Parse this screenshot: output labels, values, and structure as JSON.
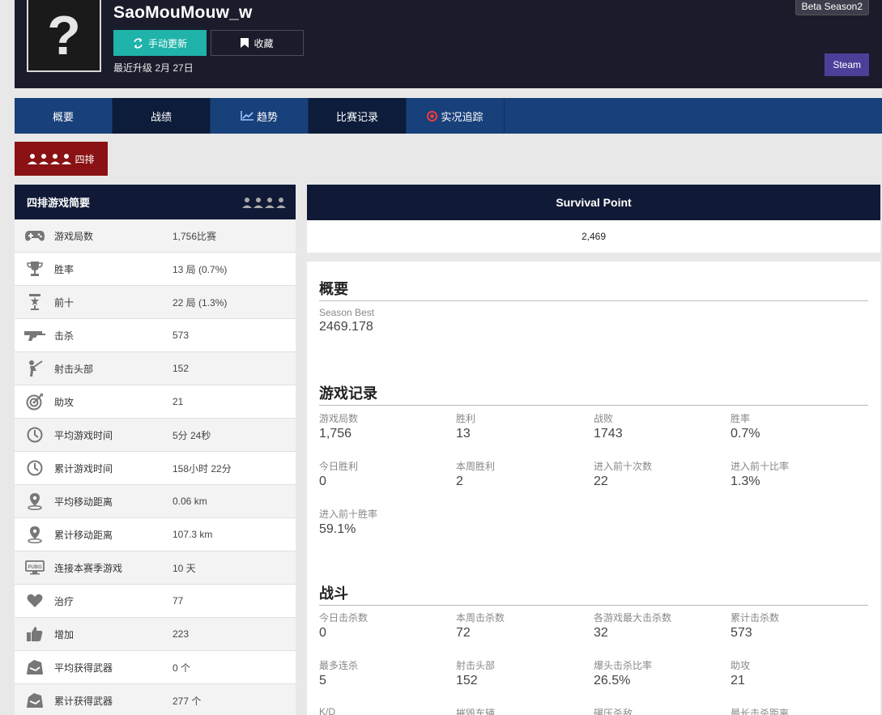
{
  "header": {
    "avatar_glyph": "?",
    "player_name": "SaoMouMouw_w",
    "refresh_label": "手动更新",
    "favorite_label": "收藏",
    "last_update": "最近升级 2月 27日",
    "season_badge": "Beta Season2",
    "platform_badge": "Steam"
  },
  "nav": {
    "overview": "概要",
    "record": "战绩",
    "trend": "趋势",
    "matches": "比赛记录",
    "live": "实况追踪"
  },
  "mode_button": "四排",
  "summary": {
    "title": "四排游戏简要",
    "rows": [
      {
        "icon": "gamepad-icon",
        "label": "游戏局数",
        "value": "1,756比赛"
      },
      {
        "icon": "trophy-icon",
        "label": "胜率",
        "value": "13 局 (0.7%)"
      },
      {
        "icon": "medal-icon",
        "label": "前十",
        "value": "22 局 (1.3%)"
      },
      {
        "icon": "gun-icon",
        "label": "击杀",
        "value": "573"
      },
      {
        "icon": "headshot-icon",
        "label": "射击头部",
        "value": "152"
      },
      {
        "icon": "target-icon",
        "label": "助攻",
        "value": "21"
      },
      {
        "icon": "clock-icon",
        "label": "平均游戏时间",
        "value": "5分 24秒"
      },
      {
        "icon": "clock-icon",
        "label": "累计游戏时间",
        "value": "158小时 22分"
      },
      {
        "icon": "location-icon",
        "label": "平均移动距离",
        "value": "0.06 km"
      },
      {
        "icon": "location-icon",
        "label": "累计移动距离",
        "value": "107.3 km"
      },
      {
        "icon": "pubg-logo-icon",
        "label": "连接本赛季游戏",
        "value": "10 天"
      },
      {
        "icon": "heart-icon",
        "label": "治疗",
        "value": "77"
      },
      {
        "icon": "thumbs-up-icon",
        "label": "增加",
        "value": "223"
      },
      {
        "icon": "backpack-icon",
        "label": "平均获得武器",
        "value": "0 个"
      },
      {
        "icon": "backpack-icon",
        "label": "累计获得武器",
        "value": "277 个"
      }
    ]
  },
  "survival": {
    "title": "Survival Point",
    "value": "2,469"
  },
  "overview": {
    "title": "概要",
    "season_best_label": "Season Best",
    "season_best_value": "2469.178"
  },
  "game_record": {
    "title": "游戏记录",
    "cells": [
      {
        "label": "游戏局数",
        "value": "1,756"
      },
      {
        "label": "胜利",
        "value": "13"
      },
      {
        "label": "战败",
        "value": "1743"
      },
      {
        "label": "胜率",
        "value": "0.7%"
      },
      {
        "label": "今日胜利",
        "value": "0"
      },
      {
        "label": "本周胜利",
        "value": "2"
      },
      {
        "label": "进入前十次数",
        "value": "22"
      },
      {
        "label": "进入前十比率",
        "value": "1.3%"
      },
      {
        "label": "进入前十胜率",
        "value": "59.1%"
      }
    ]
  },
  "combat": {
    "title": "战斗",
    "cells": [
      {
        "label": "今日击杀数",
        "value": "0"
      },
      {
        "label": "本周击杀数",
        "value": "72"
      },
      {
        "label": "各游戏最大击杀数",
        "value": "32"
      },
      {
        "label": "累计击杀数",
        "value": "573"
      },
      {
        "label": "最多连杀",
        "value": "5"
      },
      {
        "label": "射击头部",
        "value": "152"
      },
      {
        "label": "爆头击杀比率",
        "value": "26.5%"
      },
      {
        "label": "助攻",
        "value": "21"
      },
      {
        "label": "K/D",
        "value": ""
      },
      {
        "label": "摧毁车辆",
        "value": ""
      },
      {
        "label": "碾压杀敌",
        "value": ""
      },
      {
        "label": "最长击杀距离",
        "value": ""
      }
    ]
  }
}
